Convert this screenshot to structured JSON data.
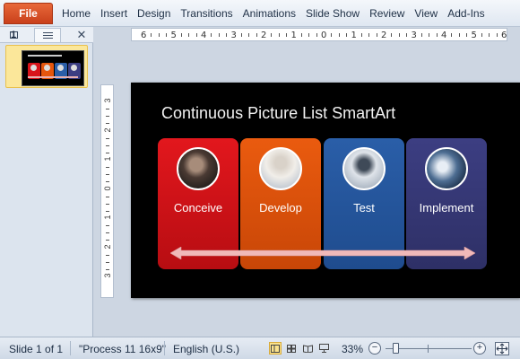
{
  "ribbon": {
    "file_label": "File",
    "tabs": [
      "Home",
      "Insert",
      "Design",
      "Transitions",
      "Animations",
      "Slide Show",
      "Review",
      "View",
      "Add-Ins"
    ]
  },
  "panel": {
    "slides_tab_icon": "slide-thumbnail-icon",
    "outline_tab_icon": "outline-lines-icon",
    "close_glyph": "✕",
    "slide_number": "1"
  },
  "rulers": {
    "horizontal_ticks": [
      "6",
      "5",
      "4",
      "3",
      "2",
      "1",
      "0",
      "1",
      "2",
      "3",
      "4",
      "5",
      "6"
    ],
    "vertical_ticks": [
      "3",
      "2",
      "1",
      "0",
      "1",
      "2",
      "3"
    ]
  },
  "slide": {
    "title": "Continuous Picture List SmartArt",
    "items": [
      {
        "label": "Conceive",
        "color": "#e2171d"
      },
      {
        "label": "Develop",
        "color": "#ea5b0f"
      },
      {
        "label": "Test",
        "color": "#2a5ea8"
      },
      {
        "label": "Implement",
        "color": "#3c3e82"
      }
    ],
    "arrow_color": "#f0b9b9"
  },
  "status": {
    "slide_info": "Slide 1 of 1",
    "theme": "\"Process 11 16x9\"",
    "language": "English (U.S.)",
    "zoom": "33%",
    "zoom_out": "−",
    "zoom_in": "+"
  }
}
